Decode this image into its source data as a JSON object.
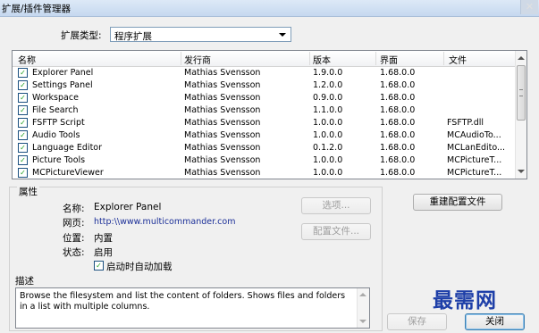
{
  "window": {
    "title": "扩展/插件管理器",
    "close_glyph": "✕"
  },
  "ext_type": {
    "label": "扩展类型:",
    "selected": "程序扩展"
  },
  "table": {
    "headers": {
      "name": "名称",
      "publisher": "发行商",
      "version": "版本",
      "ui": "界面",
      "file": "文件"
    },
    "rows": [
      {
        "checked": true,
        "name": "Explorer Panel",
        "publisher": "Mathias Svensson",
        "version": "1.9.0.0",
        "ui": "1.68.0.0",
        "file": ""
      },
      {
        "checked": true,
        "name": "Settings Panel",
        "publisher": "Mathias Svensson",
        "version": "1.2.0.0",
        "ui": "1.68.0.0",
        "file": ""
      },
      {
        "checked": true,
        "name": "Workspace",
        "publisher": "Mathias Svensson",
        "version": "0.9.0.0",
        "ui": "1.68.0.0",
        "file": ""
      },
      {
        "checked": true,
        "name": "File Search",
        "publisher": "Mathias Svensson",
        "version": "1.1.0.0",
        "ui": "1.68.0.0",
        "file": ""
      },
      {
        "checked": true,
        "name": "FSFTP Script",
        "publisher": "Mathias Svensson",
        "version": "1.0.0.0",
        "ui": "1.68.0.0",
        "file": "FSFTP.dll"
      },
      {
        "checked": true,
        "name": "Audio Tools",
        "publisher": "Mathias Svensson",
        "version": "1.0.0.0",
        "ui": "1.68.0.0",
        "file": "MCAudioTo..."
      },
      {
        "checked": true,
        "name": "Language Editor",
        "publisher": "Mathias Svensson",
        "version": "0.1.2.0",
        "ui": "1.68.0.0",
        "file": "MCLanEdito..."
      },
      {
        "checked": true,
        "name": "Picture Tools",
        "publisher": "Mathias Svensson",
        "version": "1.0.0.0",
        "ui": "1.68.0.0",
        "file": "MCPictureT..."
      },
      {
        "checked": true,
        "name": "MCPictureViewer",
        "publisher": "Mathias Svensson",
        "version": "1.0.0.0",
        "ui": "1.68.0.0",
        "file": "MCPictureT..."
      }
    ]
  },
  "properties": {
    "group_label": "属性",
    "name_label": "名称:",
    "name_value": "Explorer Panel",
    "web_label": "网页:",
    "web_value": "http:\\\\www.multicommander.com",
    "location_label": "位置:",
    "location_value": "内置",
    "status_label": "状态:",
    "status_value": "启用",
    "autoload_label": "启动时自动加载",
    "autoload_checked": true
  },
  "description": {
    "label": "描述",
    "text": "Browse the filesystem and list the content of folders. Shows files and folders in a list with multiple columns."
  },
  "buttons": {
    "options": "选项...",
    "config_file": "配置文件...",
    "rebuild_config": "重建配置文件",
    "save": "保存",
    "close": "关闭"
  },
  "watermark": "最需网",
  "check_glyph": "✓"
}
